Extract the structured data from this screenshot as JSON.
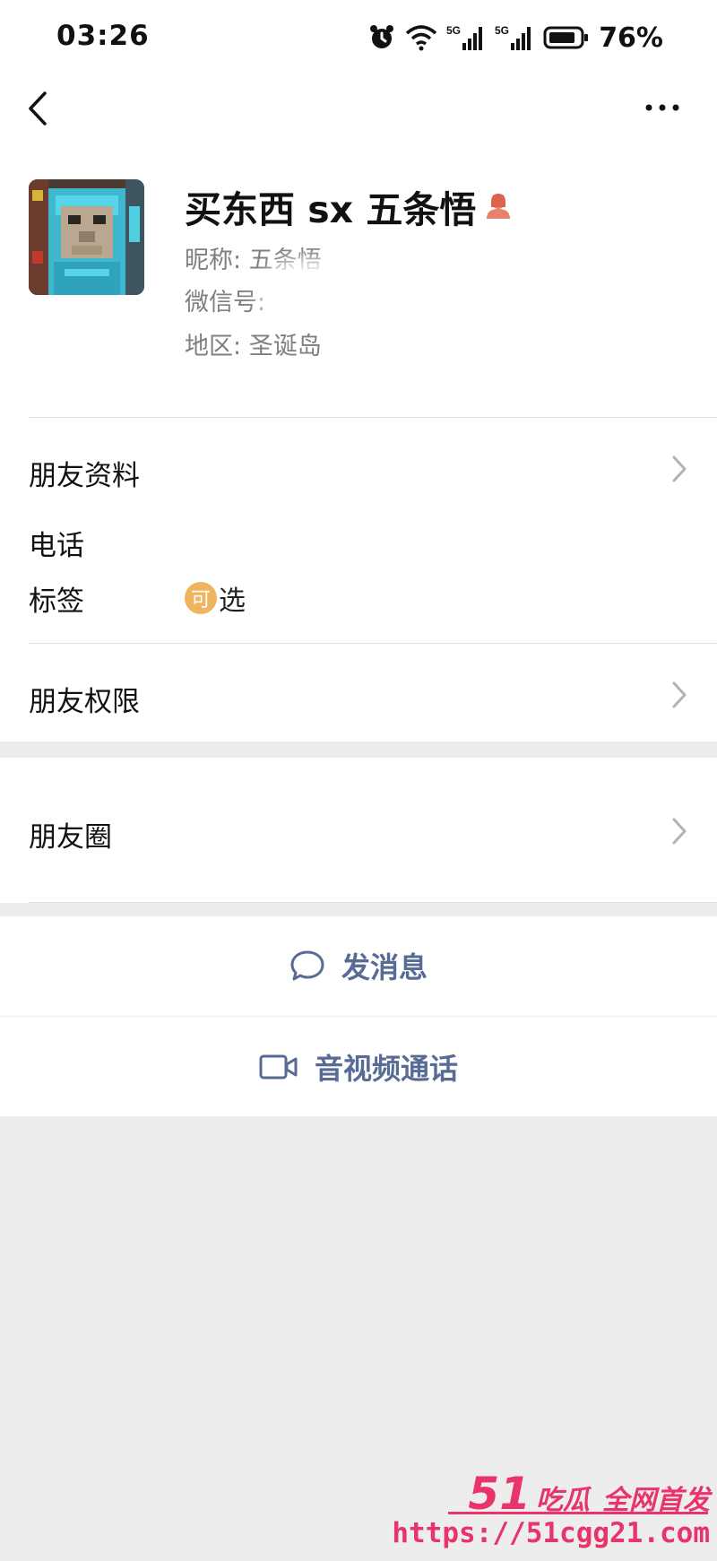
{
  "status_bar": {
    "time": "03:26",
    "battery": "76%",
    "icons": [
      "alarm-icon",
      "wifi-icon",
      "5g-signal-icon",
      "5g-signal-icon",
      "battery-icon"
    ]
  },
  "nav": {
    "back_icon": "chevron-left-icon",
    "more_icon": "more-horizontal-icon"
  },
  "profile": {
    "display_name": "买东西 sx 五条悟",
    "gender_icon": "female-user-icon",
    "nickname_label": "昵称:",
    "nickname": "五条悟",
    "wechat_id_label": "微信号:",
    "wechat_id": "",
    "region_label": "地区:",
    "region": "圣诞岛"
  },
  "rows": {
    "friend_info": "朋友资料",
    "phone": "电话",
    "tags": "标签",
    "tags_badge": "可",
    "tags_value": "选",
    "permissions": "朋友权限",
    "moments": "朋友圈"
  },
  "actions": {
    "message": "发消息",
    "message_icon": "chat-bubble-icon",
    "call": "音视频通话",
    "call_icon": "video-camera-icon"
  },
  "watermark": {
    "brand_number": "51",
    "brand_name": "吃瓜",
    "slogan": "全网首发",
    "url": "https://51cgg21.com"
  },
  "colors": {
    "accent_link": "#576b95",
    "watermark": "#e8336b",
    "tag_badge": "#f0b45e",
    "page_bg": "#ededed"
  }
}
